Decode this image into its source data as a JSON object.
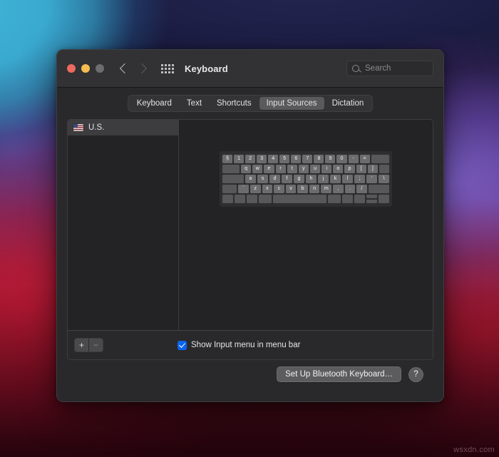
{
  "window": {
    "title": "Keyboard",
    "traffic_lights": [
      "close",
      "minimize",
      "zoom"
    ],
    "nav": {
      "back": "back-chevron",
      "forward": "forward-chevron"
    },
    "grid_icon": "show-all-grid-icon",
    "search": {
      "placeholder": "Search",
      "value": "",
      "icon": "search-icon"
    }
  },
  "tabs": [
    {
      "label": "Keyboard",
      "active": false
    },
    {
      "label": "Text",
      "active": false
    },
    {
      "label": "Shortcuts",
      "active": false
    },
    {
      "label": "Input Sources",
      "active": true
    },
    {
      "label": "Dictation",
      "active": false
    }
  ],
  "sidebar": {
    "items": [
      {
        "label": "U.S.",
        "icon": "us-flag-icon",
        "selected": true
      }
    ],
    "add_label": "+",
    "remove_label": "−"
  },
  "keyboard_preview": {
    "rows": [
      [
        "§",
        "1",
        "2",
        "3",
        "4",
        "5",
        "6",
        "7",
        "8",
        "9",
        "0",
        "-",
        "=",
        ""
      ],
      [
        "",
        "q",
        "w",
        "e",
        "r",
        "t",
        "y",
        "u",
        "i",
        "o",
        "p",
        "[",
        "]",
        ""
      ],
      [
        "",
        "a",
        "s",
        "d",
        "f",
        "g",
        "h",
        "j",
        "k",
        "l",
        ";",
        "'",
        "\\"
      ],
      [
        "",
        "`",
        "z",
        "x",
        "c",
        "v",
        "b",
        "n",
        "m",
        ",",
        ".",
        "/",
        ""
      ],
      [
        "",
        "",
        "",
        "",
        "",
        "",
        "",
        "",
        "",
        ""
      ]
    ]
  },
  "options": {
    "show_input_menu": {
      "label": "Show Input menu in menu bar",
      "checked": true
    }
  },
  "footer": {
    "bluetooth_button": "Set Up Bluetooth Keyboard…",
    "help_button": "?"
  },
  "watermark": "wsxdn.com",
  "colors": {
    "accent": "#0a64f0",
    "window_bg": "#29292b",
    "panel_bg": "#232325",
    "titlebar_bg": "#323234",
    "selected_row": "#3d3d40",
    "key_face": "#6c6c6f",
    "traffic_red": "#ee6a5f",
    "traffic_yellow": "#f5bd4f",
    "traffic_gray": "#6d6d70"
  }
}
